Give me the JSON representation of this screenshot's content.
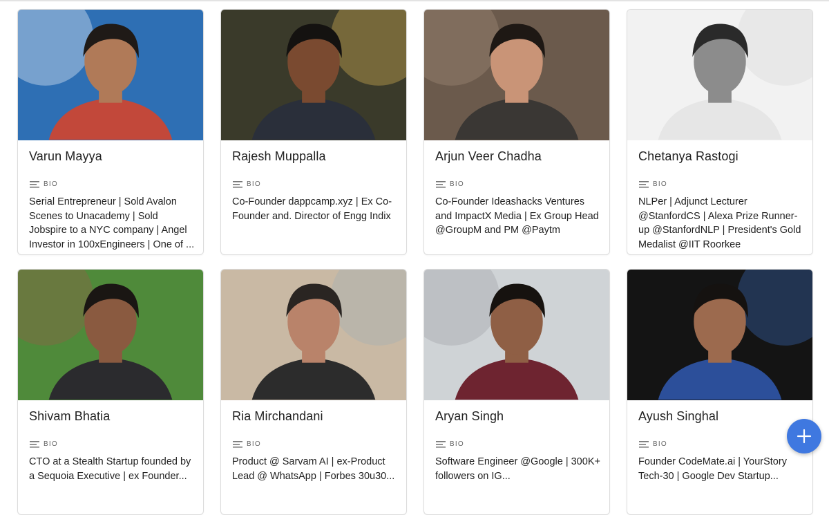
{
  "bio_label": "BIO",
  "cards": [
    {
      "name": "Varun Mayya",
      "bio": "Serial Entrepreneur | Sold Avalon Scenes to Unacademy | Sold Jobspire to a NYC company | Angel Investor in 100xEngineers | One of ...",
      "bg": "#2e6fb4",
      "accent": "#ffffff",
      "shirt": "#c2483a",
      "skin": "#b07a58",
      "hair": "#1f1a17"
    },
    {
      "name": "Rajesh Muppalla",
      "bio": "Co-Founder dappcamp.xyz | Ex Co-Founder and. Director of Engg Indix",
      "bg": "#3a3a2a",
      "accent": "#e8c15a",
      "shirt": "#2a2f3a",
      "skin": "#7a4a30",
      "hair": "#141210"
    },
    {
      "name": "Arjun Veer Chadha",
      "bio": "Co-Founder Ideashacks Ventures and ImpactX Media | Ex Group Head @GroupM and PM @Paytm",
      "bg": "#6b5a4c",
      "accent": "#a8927e",
      "shirt": "#3a3734",
      "skin": "#c99477",
      "hair": "#1e1814"
    },
    {
      "name": "Chetanya Rastogi",
      "bio": "NLPer | Adjunct Lecturer @StanfordCS | Alexa Prize Runner-up @StanfordNLP | President's Gold Medalist @IIT Roorkee",
      "bg": "#f2f2f2",
      "accent": "#d8d8d8",
      "shirt": "#e6e6e6",
      "skin": "#8c8c8c",
      "hair": "#2a2a2a"
    },
    {
      "name": "Shivam Bhatia",
      "bio": "CTO at a Stealth Startup founded by a Sequoia Executive | ex Founder...",
      "bg": "#4f8a3a",
      "accent": "#9a5a4a",
      "shirt": "#2b2b2e",
      "skin": "#8a5a40",
      "hair": "#1a1613"
    },
    {
      "name": "Ria Mirchandani",
      "bio": "Product @ Sarvam AI | ex-Product Lead @ WhatsApp | Forbes 30u30...",
      "bg": "#c9b9a4",
      "accent": "#9fb0b8",
      "shirt": "#2c2c2c",
      "skin": "#b9836a",
      "hair": "#2a2522"
    },
    {
      "name": "Aryan Singh",
      "bio": "Software Engineer @Google | 300K+ followers on IG...",
      "bg": "#cfd3d6",
      "accent": "#9a9ea2",
      "shirt": "#6e2430",
      "skin": "#8f5f45",
      "hair": "#16120f"
    },
    {
      "name": "Ayush Singhal",
      "bio": "Founder CodeMate.ai | YourStory Tech-30 | Google Dev Startup...",
      "bg": "#141414",
      "accent": "#3d6fc4",
      "shirt": "#2c4f9a",
      "skin": "#9c6a4e",
      "hair": "#151210"
    }
  ],
  "fab": {
    "icon": "plus-icon",
    "color": "#3f78e0"
  }
}
